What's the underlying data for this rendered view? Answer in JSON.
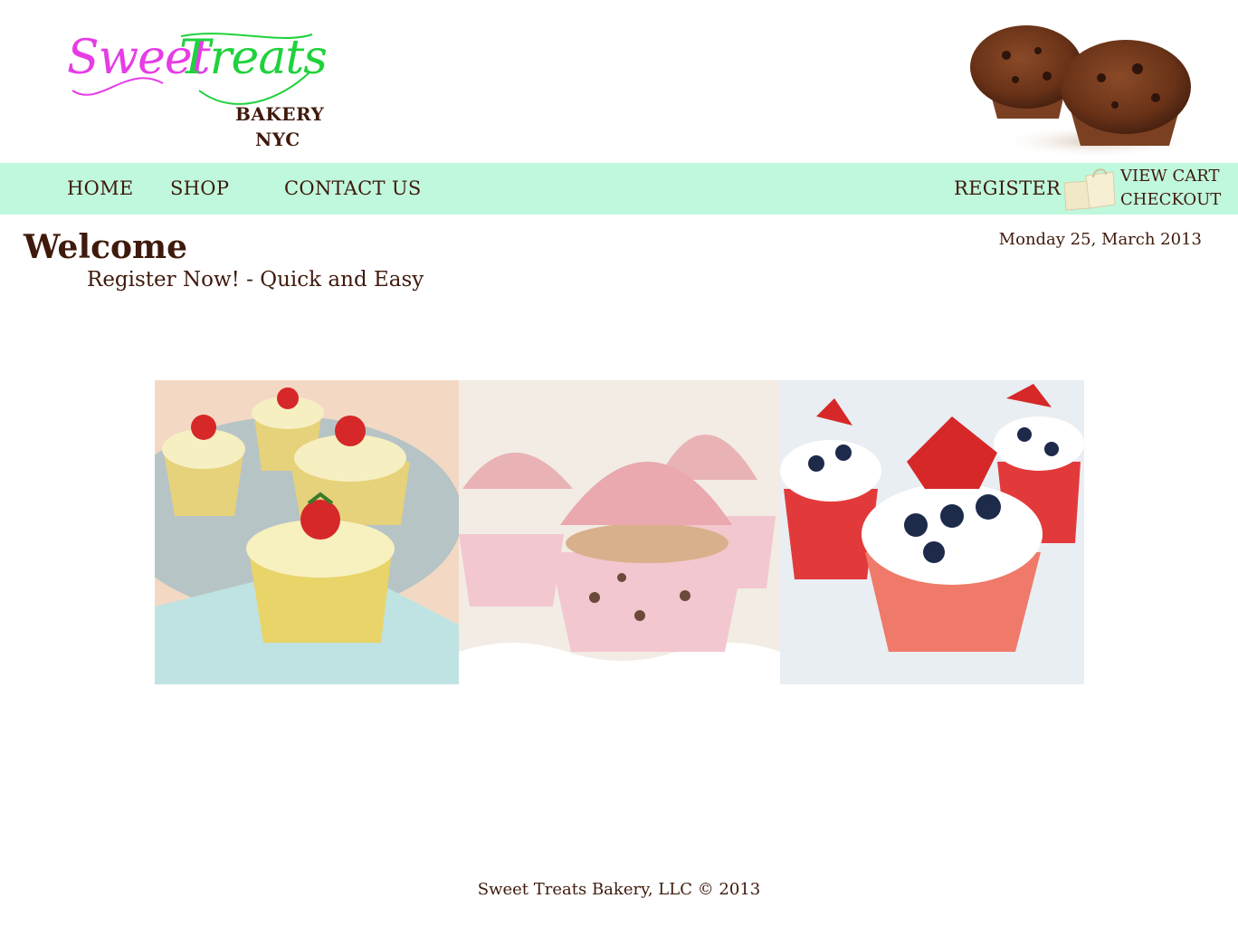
{
  "brand": {
    "word1": "Sweet",
    "word2": "Treats",
    "line1": "BAKERY",
    "line2": "NYC",
    "colors": {
      "pink": "#e63ce6",
      "green": "#1fd23c",
      "brown": "#3f1a0c",
      "nav_bg": "#bff8dd"
    }
  },
  "nav": {
    "home": "HOME",
    "shop": "SHOP",
    "contact": "CONTACT US",
    "register": "REGISTER",
    "view_cart": "VIEW CART",
    "checkout": "CHECKOUT"
  },
  "main": {
    "heading": "Welcome",
    "subheading": "Register Now! - Quick and Easy",
    "date": "Monday 25, March 2013"
  },
  "gallery": {
    "images": [
      "strawberry-cupcakes-photo",
      "pink-frosted-cupcakes-photo",
      "berry-cream-cupcakes-photo"
    ]
  },
  "footer": {
    "text": "Sweet Treats Bakery, LLC © 2013"
  }
}
